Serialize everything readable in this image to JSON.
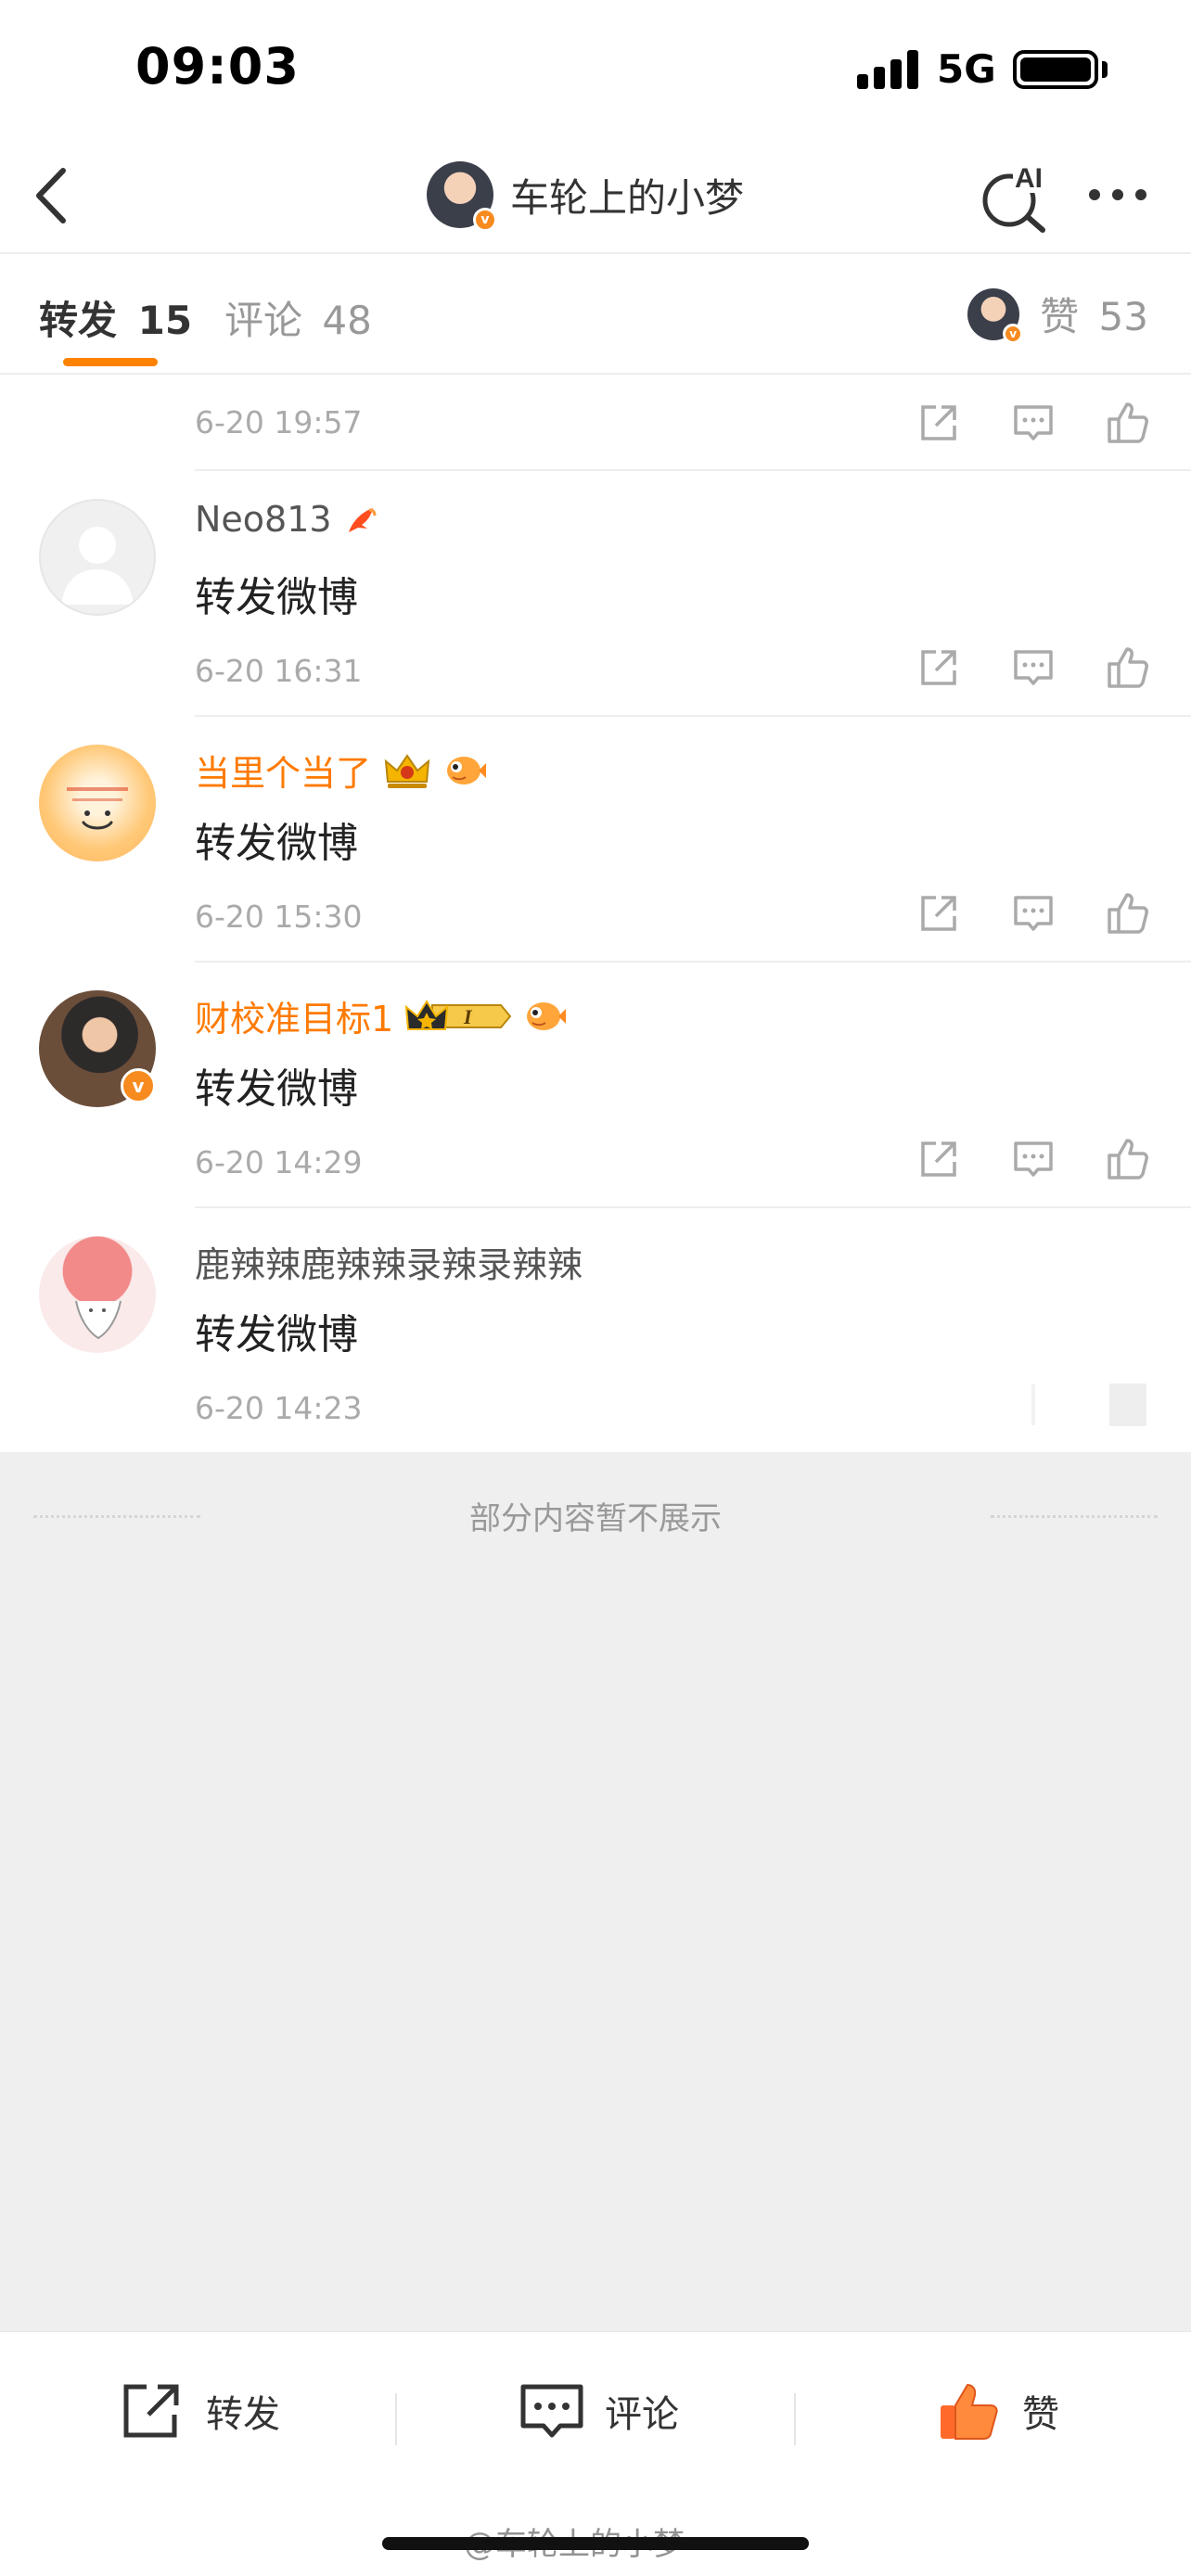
{
  "status_bar": {
    "time": "09:03",
    "network": "5G",
    "signal_icon": "signal-bars-icon",
    "battery_icon": "battery-icon"
  },
  "nav": {
    "title": "车轮上的小梦",
    "verified_mark": "v",
    "ai_label": "AI"
  },
  "tabs": {
    "reposts": {
      "label": "转发",
      "count": "15"
    },
    "comments": {
      "label": "评论",
      "count": "48"
    },
    "likes": {
      "label": "赞",
      "count": "53"
    }
  },
  "feed": {
    "partial_top": {
      "timestamp": "6-20 19:57"
    },
    "items": [
      {
        "username": "Neo813",
        "content": "转发微博",
        "timestamp": "6-20 16:31",
        "vip": false,
        "badges": [
          "koi-fish-icon"
        ]
      },
      {
        "username": "当里个当了",
        "content": "转发微博",
        "timestamp": "6-20 15:30",
        "vip": true,
        "badges": [
          "crown-badge-icon",
          "pufferfish-icon"
        ]
      },
      {
        "username": "财校准目标1",
        "content": "转发微博",
        "timestamp": "6-20 14:29",
        "vip": true,
        "level_label": "I",
        "badges": [
          "crown-level-badge-icon",
          "pufferfish-icon"
        ]
      },
      {
        "username": "鹿辣辣鹿辣辣录辣录辣辣",
        "content": "转发微博",
        "timestamp": "6-20 14:23",
        "vip": false,
        "badges": []
      }
    ]
  },
  "hidden_note": "部分内容暂不展示",
  "bottom_bar": {
    "repost": "转发",
    "comment": "评论",
    "like": "赞"
  },
  "watermark": "@车轮上的小梦",
  "colors": {
    "accent": "#ff8200",
    "vip_name": "#ff7a00",
    "muted": "#999999"
  }
}
